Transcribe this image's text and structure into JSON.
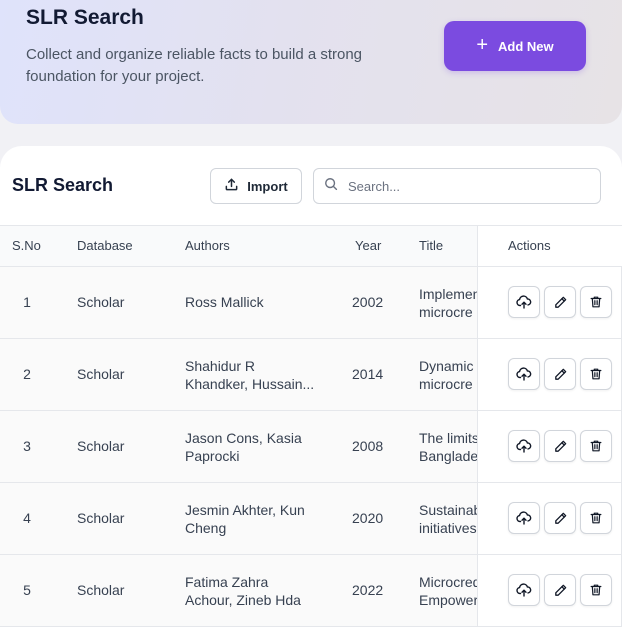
{
  "header": {
    "title": "SLR Search",
    "description": "Collect and organize reliable facts to build a strong foundation for your project.",
    "add_button_label": "Add New"
  },
  "card": {
    "title": "SLR Search",
    "import_label": "Import",
    "search_placeholder": "Search..."
  },
  "table": {
    "columns": {
      "sno": "S.No",
      "database": "Database",
      "authors": "Authors",
      "year": "Year",
      "title": "Title",
      "actions": "Actions"
    },
    "rows": [
      {
        "sno": "1",
        "database": "Scholar",
        "authors": [
          "Ross Mallick"
        ],
        "year": "2002",
        "title": [
          "Implemen",
          "microcre"
        ]
      },
      {
        "sno": "2",
        "database": "Scholar",
        "authors": [
          "Shahidur R",
          "Khandker, Hussain..."
        ],
        "year": "2014",
        "title": [
          "Dynamic",
          "microcre"
        ]
      },
      {
        "sno": "3",
        "database": "Scholar",
        "authors": [
          "Jason Cons, Kasia",
          "Paprocki"
        ],
        "year": "2008",
        "title": [
          "The limits",
          "Banglade"
        ]
      },
      {
        "sno": "4",
        "database": "Scholar",
        "authors": [
          "Jesmin Akhter, Kun",
          "Cheng"
        ],
        "year": "2020",
        "title": [
          "Sustainab",
          "initiatives"
        ]
      },
      {
        "sno": "5",
        "database": "Scholar",
        "authors": [
          "Fatima Zahra",
          "Achour, Zineb Hda"
        ],
        "year": "2022",
        "title": [
          "Microcred",
          "Empower"
        ]
      }
    ]
  },
  "icons": {
    "add": "plus-icon",
    "import": "upload-icon",
    "search": "search-icon",
    "row_actions": [
      "cloud-upload-icon",
      "pencil-icon",
      "trash-icon"
    ]
  },
  "colors": {
    "accent": "#7b4be0",
    "banner_start": "#dfe3fb",
    "banner_end": "#e7e3e6"
  }
}
